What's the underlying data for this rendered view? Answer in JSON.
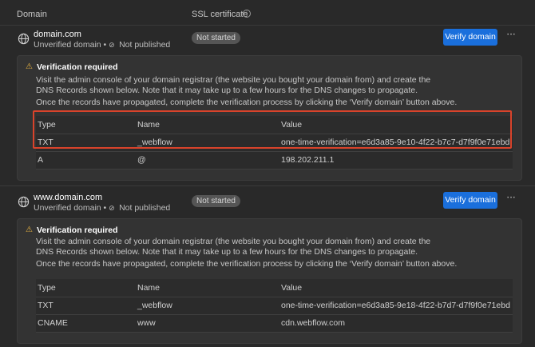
{
  "header": {
    "domain_label": "Domain",
    "ssl_label": "SSL certificate",
    "info_icon": "info-icon"
  },
  "domains": [
    {
      "name": "domain.com",
      "status_text": "Unverified domain • ",
      "publish_text": "Not published",
      "ssl_badge": "Not started",
      "verify_label": "Verify domain",
      "more_label": "···",
      "panel": {
        "title": "Verification required",
        "paragraph1_line1": "Visit the admin console of your domain registrar (the website you bought your domain from) and create the",
        "paragraph1_line2": "DNS Records shown below. Note that it may take up to a few hours for the DNS changes to propagate.",
        "paragraph2": "Once the records have propagated, complete the verification process by clicking the ‘Verify domain’ button above.",
        "columns": [
          "Type",
          "Name",
          "Value"
        ],
        "rows": [
          {
            "type": "TXT",
            "name": "_webflow",
            "value": "one-time-verification=e6d3a85-9e10-4f22-b7c7-d7f9f0e71ebd"
          },
          {
            "type": "A",
            "name": "@",
            "value": "198.202.211.1"
          }
        ]
      }
    },
    {
      "name": "www.domain.com",
      "status_text": "Unverified domain • ",
      "publish_text": "Not published",
      "ssl_badge": "Not started",
      "verify_label": "Verify domain",
      "more_label": "···",
      "panel": {
        "title": "Verification required",
        "paragraph1_line1": "Visit the admin console of your domain registrar (the website you bought your domain from) and create the",
        "paragraph1_line2": "DNS Records shown below. Note that it may take up to a few hours for the DNS changes to propagate.",
        "paragraph2": "Once the records have propagated, complete the verification process by clicking the ‘Verify domain’ button above.",
        "columns": [
          "Type",
          "Name",
          "Value"
        ],
        "rows": [
          {
            "type": "TXT",
            "name": "_webflow",
            "value": "one-time-verification=e6d3a85-9e18-4f22-b7d7-d7f9f0e71ebd"
          },
          {
            "type": "CNAME",
            "name": "www",
            "value": "cdn.webflow.com"
          }
        ]
      }
    }
  ],
  "colors": {
    "accent": "#1a6fdc",
    "warning": "#e8b341",
    "highlight": "#d9432b",
    "background": "#292929"
  }
}
